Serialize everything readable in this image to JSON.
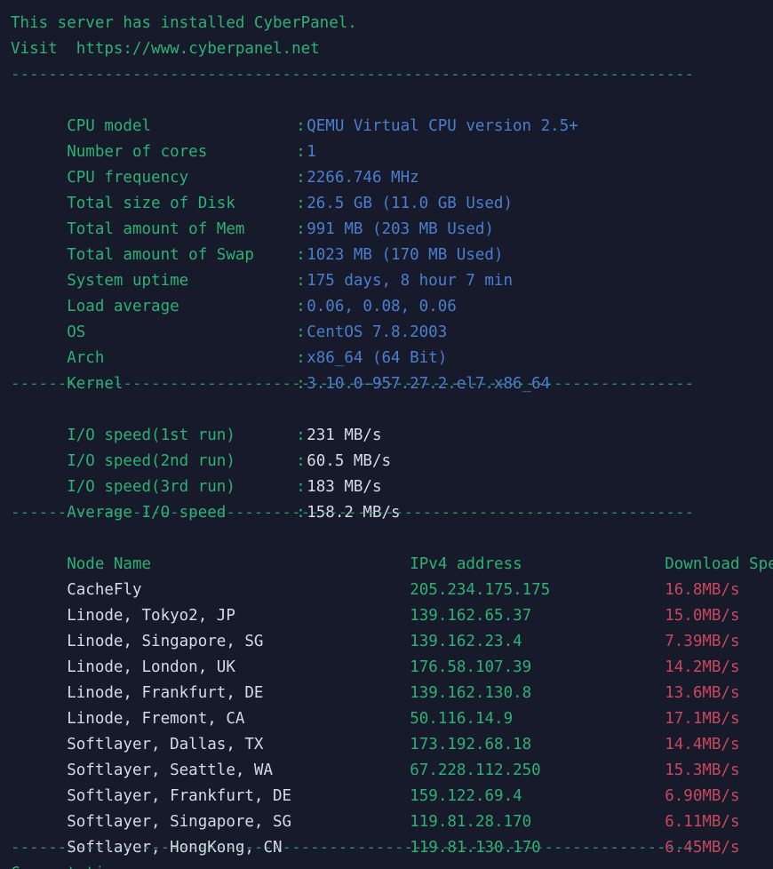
{
  "terminal": {
    "background": "#161a2b",
    "colors": {
      "label_green": "#2fb173",
      "value_blue": "#4b7fce",
      "value_white": "#d6dbe6",
      "speed_red": "#c8485c",
      "separator_green": "#2e8f6e"
    },
    "header": {
      "line1": "This server has installed CyberPanel.",
      "line2": "Visit  https://www.cyberpanel.net"
    },
    "separator": "-------------------------------------------------------------------------",
    "system_info": [
      {
        "label": "CPU model",
        "colon": ":",
        "value": "QEMU Virtual CPU version 2.5+"
      },
      {
        "label": "Number of cores",
        "colon": ":",
        "value": "1"
      },
      {
        "label": "CPU frequency",
        "colon": ":",
        "value": "2266.746 MHz"
      },
      {
        "label": "Total size of Disk",
        "colon": ":",
        "value": "26.5 GB (11.0 GB Used)"
      },
      {
        "label": "Total amount of Mem",
        "colon": ":",
        "value": "991 MB (203 MB Used)"
      },
      {
        "label": "Total amount of Swap",
        "colon": ":",
        "value": "1023 MB (170 MB Used)"
      },
      {
        "label": "System uptime",
        "colon": ":",
        "value": "175 days, 8 hour 7 min"
      },
      {
        "label": "Load average",
        "colon": ":",
        "value": "0.06, 0.08, 0.06"
      },
      {
        "label": "OS",
        "colon": ":",
        "value": "CentOS 7.8.2003"
      },
      {
        "label": "Arch",
        "colon": ":",
        "value": "x86_64 (64 Bit)"
      },
      {
        "label": "Kernel",
        "colon": ":",
        "value": "3.10.0-957.27.2.el7.x86_64"
      }
    ],
    "io_speeds": [
      {
        "label": "I/O speed(1st run)",
        "colon": ":",
        "value": "231 MB/s"
      },
      {
        "label": "I/O speed(2nd run)",
        "colon": ":",
        "value": "60.5 MB/s"
      },
      {
        "label": "I/O speed(3rd run)",
        "colon": ":",
        "value": "183 MB/s"
      },
      {
        "label": "Average I/O speed",
        "colon": ":",
        "value": "158.2 MB/s"
      }
    ],
    "node_table": {
      "headers": {
        "node_name": "Node Name",
        "ipv4": "IPv4 address",
        "download_speed": "Download Speed"
      },
      "rows": [
        {
          "node_name": "CacheFly",
          "ipv4": "205.234.175.175",
          "download_speed": "16.8MB/s"
        },
        {
          "node_name": "Linode, Tokyo2, JP",
          "ipv4": "139.162.65.37",
          "download_speed": "15.0MB/s"
        },
        {
          "node_name": "Linode, Singapore, SG",
          "ipv4": "139.162.23.4",
          "download_speed": "7.39MB/s"
        },
        {
          "node_name": "Linode, London, UK",
          "ipv4": "176.58.107.39",
          "download_speed": "14.2MB/s"
        },
        {
          "node_name": "Linode, Frankfurt, DE",
          "ipv4": "139.162.130.8",
          "download_speed": "13.6MB/s"
        },
        {
          "node_name": "Linode, Fremont, CA",
          "ipv4": "50.116.14.9",
          "download_speed": "17.1MB/s"
        },
        {
          "node_name": "Softlayer, Dallas, TX",
          "ipv4": "173.192.68.18",
          "download_speed": "14.4MB/s"
        },
        {
          "node_name": "Softlayer, Seattle, WA",
          "ipv4": "67.228.112.250",
          "download_speed": "15.3MB/s"
        },
        {
          "node_name": "Softlayer, Frankfurt, DE",
          "ipv4": "159.122.69.4",
          "download_speed": "6.90MB/s"
        },
        {
          "node_name": "Softlayer, Singapore, SG",
          "ipv4": "119.81.28.170",
          "download_speed": "6.11MB/s"
        },
        {
          "node_name": "Softlayer, HongKong, CN",
          "ipv4": "119.81.130.170",
          "download_speed": "6.45MB/s"
        }
      ]
    },
    "footer_clipped": "Current time"
  }
}
